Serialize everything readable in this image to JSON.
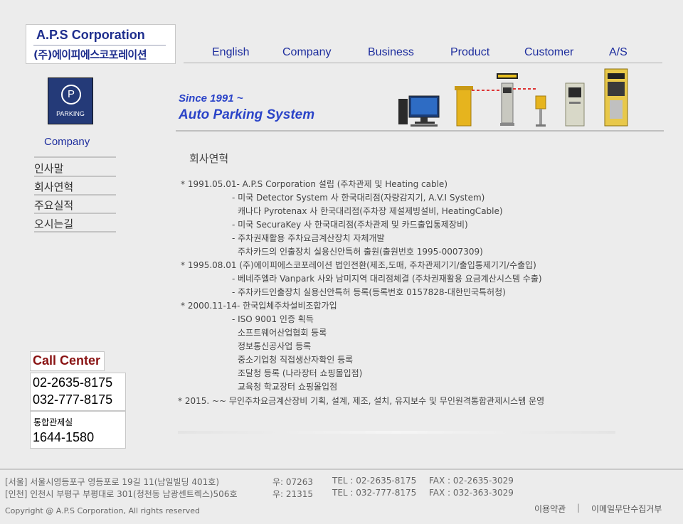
{
  "logo": {
    "name_en": "A.P.S Corporation",
    "name_ko": "(주)에이피에스코포레이션"
  },
  "nav": {
    "items": [
      "English",
      "Company",
      "Business",
      "Product",
      "Customer",
      "A/S"
    ]
  },
  "badge": {
    "letter": "P",
    "label": "PARKING"
  },
  "banner": {
    "since": "Since 1991 ~",
    "slogan": "Auto Parking System"
  },
  "sidebar": {
    "title": "Company",
    "items": [
      "인사말",
      "회사연혁",
      "주요실적",
      "오시는길"
    ]
  },
  "call_center": {
    "title": "Call Center",
    "phones": [
      "02-2635-8175",
      "032-777-8175"
    ],
    "center_label": "통합관제실",
    "center_phone": "1644-1580"
  },
  "content": {
    "title": "회사연혁",
    "lines": [
      "* 1991.05.01- A.P.S Corporation 설립 (주차관제 및 Heating cable)",
      "- 미국 Detector System 사 한국대리점(자량감지기, A.V.I System)",
      "캐나다 Pyrotenax 사 한국대리점(주차장 제설제빙설비, HeatingCable)",
      "- 미국 SecuraKey 사 한국대리점(주차관제 및 카드출입통제장비)",
      "- 주차권재활용 주차요금계산장치 자체개발",
      "주차카드의 인출장치 실용신안특허 출원(출원번호 1995-0007309)",
      "* 1995.08.01 (주)에이피에스코포레이션 법인전환(제조,도매, 주차관제기기/출입통제기기/수출입)",
      "- 베네주엘라 Vanpark 사와 남미지역 대리점체결 (주차권재활용 요금계산시스템 수출)",
      "- 주차카드인출장치 실용신안특허 등록(등록번호 0157828-대한민국특허청)",
      "* 2000.11-14- 한국입체주차설비조합가입",
      "- ISO 9001 인증 획득",
      "소프트웨어산업협회 등록",
      "정보통신공사업 등록",
      "중소기업청 직접생산자확인 등록",
      "조달청 등록 (나라장터 쇼핑몰입점)",
      "교육청 학교장터 쇼핑몰입점",
      "* 2015.  ~~    무인주차요금계산장비 기획, 설계, 제조, 설치, 유지보수 및 무인원격통합관제시스템 운영"
    ]
  },
  "footer": {
    "seoul": {
      "address": "[서울] 서울시영등포구 영등포로 19길 11(남일빌딩 401호)",
      "postal": "우: 07263",
      "tel": "TEL : 02-2635-8175",
      "fax": "FAX : 02-2635-3029"
    },
    "incheon": {
      "address": "[인천] 인천시 부평구 부평대로 301(청천동 남광센트렉스)506호",
      "postal": "우: 21315",
      "tel": "TEL : 032-777-8175",
      "fax": "FAX : 032-363-3029"
    },
    "copyright": "Copyright @ A.P.S Corporation, All rights reserved",
    "links": [
      "이용약관",
      "|",
      "이메일무단수집거부"
    ]
  },
  "colors": {
    "accent_blue": "#1e2e9e",
    "call_red": "#8a1414",
    "background": "#ececec",
    "gate_yellow": "#e6b41e"
  }
}
